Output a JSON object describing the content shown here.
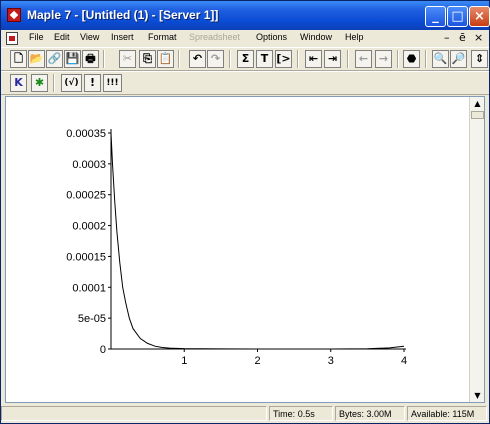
{
  "window": {
    "title": "Maple 7  - [Untitled (1) - [Server 1]]"
  },
  "titlebar_buttons": [
    "_",
    "□",
    "×"
  ],
  "menu": [
    "File",
    "Edit",
    "View",
    "Insert",
    "Format",
    "Spreadsheet",
    "Options",
    "Window",
    "Help"
  ],
  "menu_disabled": [
    "Spreadsheet"
  ],
  "mdi_controls": [
    "–",
    "ē",
    "×"
  ],
  "toolbar1": [
    {
      "name": "new-icon",
      "glyph": "🗋"
    },
    {
      "name": "open-icon",
      "glyph": "📂"
    },
    {
      "name": "open-url-icon",
      "glyph": "🔗"
    },
    {
      "name": "save-icon",
      "glyph": "💾"
    },
    {
      "name": "print-icon",
      "glyph": "🖶"
    },
    {
      "name": "cut-icon",
      "glyph": "✂"
    },
    {
      "name": "copy-icon",
      "glyph": "⎘"
    },
    {
      "name": "paste-icon",
      "glyph": "📋"
    },
    {
      "name": "undo-icon",
      "glyph": "↶"
    },
    {
      "name": "redo-icon",
      "glyph": "↷"
    },
    {
      "name": "sum-icon",
      "glyph": "Σ"
    },
    {
      "name": "text-icon",
      "glyph": "T"
    },
    {
      "name": "math-input-icon",
      "glyph": "[>"
    },
    {
      "name": "outdent-icon",
      "glyph": "⇤"
    },
    {
      "name": "indent-icon",
      "glyph": "⇥"
    },
    {
      "name": "back-icon",
      "glyph": "←"
    },
    {
      "name": "forward-icon",
      "glyph": "→"
    },
    {
      "name": "stop-icon",
      "glyph": "⬣"
    },
    {
      "name": "zoom-in-icon",
      "glyph": "🔍"
    },
    {
      "name": "zoom-out-icon",
      "glyph": "🔎"
    },
    {
      "name": "scroll-icon",
      "glyph": "⇕"
    }
  ],
  "toolbar2": [
    {
      "name": "restart-icon",
      "glyph": "K"
    },
    {
      "name": "execute-icon",
      "glyph": "✱"
    },
    {
      "name": "check-syntax-icon",
      "glyph": "(√)"
    },
    {
      "name": "exclaim-icon",
      "glyph": "!"
    },
    {
      "name": "exclaim-all-icon",
      "glyph": "!!!"
    }
  ],
  "plot": {
    "ytick_labels": [
      "0.00035",
      "0.0003",
      "0.00025",
      "0.0002",
      "0.00015",
      "0.0001",
      "5e-05",
      "0"
    ],
    "xtick_labels": [
      "1",
      "2",
      "3",
      "4"
    ]
  },
  "chart_data": {
    "type": "line",
    "xlim": [
      0,
      4
    ],
    "ylim": [
      0,
      0.00035
    ],
    "x": [
      0.0,
      0.02,
      0.05,
      0.08,
      0.12,
      0.16,
      0.2,
      0.25,
      0.3,
      0.4,
      0.5,
      0.6,
      0.7,
      0.8,
      1.0,
      1.5,
      2.0,
      2.5,
      3.0,
      3.5,
      3.8,
      4.0
    ],
    "y": [
      0.00035,
      0.0003,
      0.00024,
      0.00019,
      0.00014,
      0.0001,
      7.5e-05,
      5e-05,
      3.3e-05,
      1.7e-05,
      9e-06,
      4.5e-06,
      2.5e-06,
      1.5e-06,
      6e-07,
      2e-07,
      0.0,
      0.0,
      0.0,
      5e-07,
      1.8e-06,
      4.5e-06
    ],
    "grid": false,
    "ytick_labels": [
      "0",
      "5e-05",
      "0.0001",
      "0.00015",
      "0.0002",
      "0.00025",
      "0.0003",
      "0.00035"
    ],
    "xtick_labels": [
      "1",
      "2",
      "3",
      "4"
    ]
  },
  "status": {
    "time_label": "Time:",
    "time_value": "0.5s",
    "bytes_label": "Bytes:",
    "bytes_value": "3.00M",
    "avail_label": "Available:",
    "avail_value": "115M"
  }
}
